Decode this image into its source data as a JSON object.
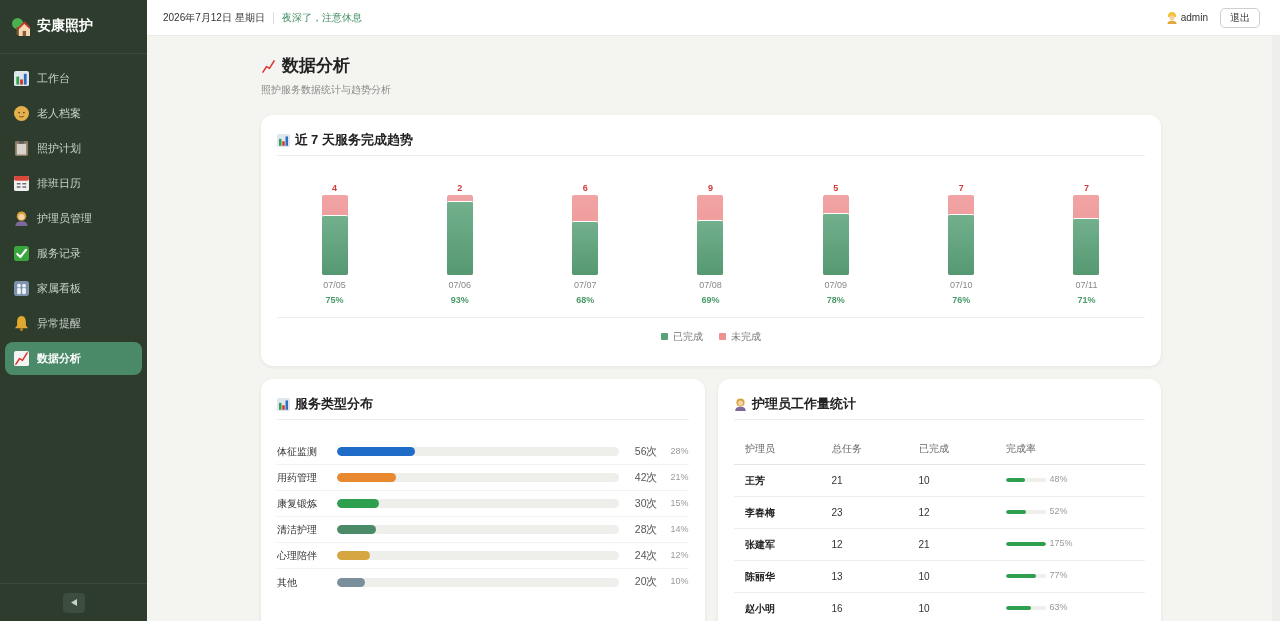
{
  "sidebar": {
    "brand": "安康照护",
    "items": [
      {
        "label": "工作台",
        "selected": false
      },
      {
        "label": "老人档案",
        "selected": false
      },
      {
        "label": "照护计划",
        "selected": false
      },
      {
        "label": "排班日历",
        "selected": false
      },
      {
        "label": "护理员管理",
        "selected": false
      },
      {
        "label": "服务记录",
        "selected": false
      },
      {
        "label": "家属看板",
        "selected": false
      },
      {
        "label": "异常提醒",
        "selected": false
      },
      {
        "label": "数据分析",
        "selected": true
      }
    ]
  },
  "topbar": {
    "date": "2026年7月12日 星期日",
    "greeting": "夜深了，注意休息",
    "user": "admin",
    "logout": "退出"
  },
  "page": {
    "title": "数据分析",
    "subtitle": "照护服务数据统计与趋势分析"
  },
  "trend": {
    "title": "近 7 天服务完成趋势",
    "days": [
      {
        "date": "07/05",
        "pending": "4",
        "rate": "75%",
        "level": 0.75
      },
      {
        "date": "07/06",
        "pending": "2",
        "rate": "93%",
        "level": 0.93
      },
      {
        "date": "07/07",
        "pending": "6",
        "rate": "68%",
        "level": 0.68
      },
      {
        "date": "07/08",
        "pending": "9",
        "rate": "69%",
        "level": 0.69
      },
      {
        "date": "07/09",
        "pending": "5",
        "rate": "78%",
        "level": 0.78
      },
      {
        "date": "07/10",
        "pending": "7",
        "rate": "76%",
        "level": 0.76
      },
      {
        "date": "07/11",
        "pending": "7",
        "rate": "71%",
        "level": 0.71
      }
    ],
    "legend": [
      {
        "label": "已完成",
        "color": "#5aa279"
      },
      {
        "label": "未完成",
        "color": "#ee9090"
      }
    ]
  },
  "service_types": {
    "title": "服务类型分布",
    "rows": [
      {
        "name": "体征监测",
        "count": "56次",
        "share": "28%",
        "level": 0.28,
        "color": "#1f6bc8"
      },
      {
        "name": "用药管理",
        "count": "42次",
        "share": "21%",
        "level": 0.21,
        "color": "#e8892f"
      },
      {
        "name": "康复锻炼",
        "count": "30次",
        "share": "15%",
        "level": 0.15,
        "color": "#2e9e4f"
      },
      {
        "name": "清洁护理",
        "count": "28次",
        "share": "14%",
        "level": 0.14,
        "color": "#4a8a68"
      },
      {
        "name": "心理陪伴",
        "count": "24次",
        "share": "12%",
        "level": 0.12,
        "color": "#d6a640"
      },
      {
        "name": "其他",
        "count": "20次",
        "share": "10%",
        "level": 0.1,
        "color": "#7a8f9c"
      }
    ]
  },
  "workload": {
    "title": "护理员工作量统计",
    "columns": [
      "护理员",
      "总任务",
      "已完成",
      "完成率"
    ],
    "rows": [
      {
        "name": "王芳",
        "total": "21",
        "done": "10",
        "rate": "48%",
        "level": 0.48
      },
      {
        "name": "李春梅",
        "total": "23",
        "done": "12",
        "rate": "52%",
        "level": 0.52
      },
      {
        "name": "张建军",
        "total": "12",
        "done": "21",
        "rate": "175%",
        "level": 1
      },
      {
        "name": "陈丽华",
        "total": "13",
        "done": "10",
        "rate": "77%",
        "level": 0.77
      },
      {
        "name": "赵小明",
        "total": "16",
        "done": "10",
        "rate": "63%",
        "level": 0.63
      }
    ]
  }
}
